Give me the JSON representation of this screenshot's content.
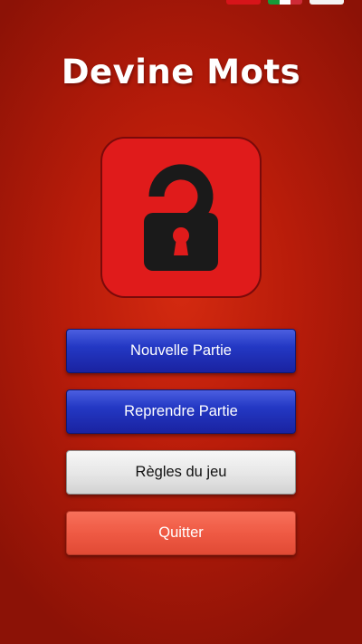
{
  "app": {
    "title": "Devine Mots"
  },
  "logo": {
    "icon": "unlocked-padlock-question-mark-icon",
    "background_color": "#e01b1b",
    "glyph_color": "#1a1a1a"
  },
  "menu": {
    "new_game_label": "Nouvelle Partie",
    "resume_label": "Reprendre Partie",
    "rules_label": "Règles du jeu",
    "quit_label": "Quitter"
  },
  "colors": {
    "background": "#c0200c",
    "primary_button": "#2338c4",
    "secondary_button": "#e6e6e6",
    "quit_button": "#ef5a44"
  }
}
